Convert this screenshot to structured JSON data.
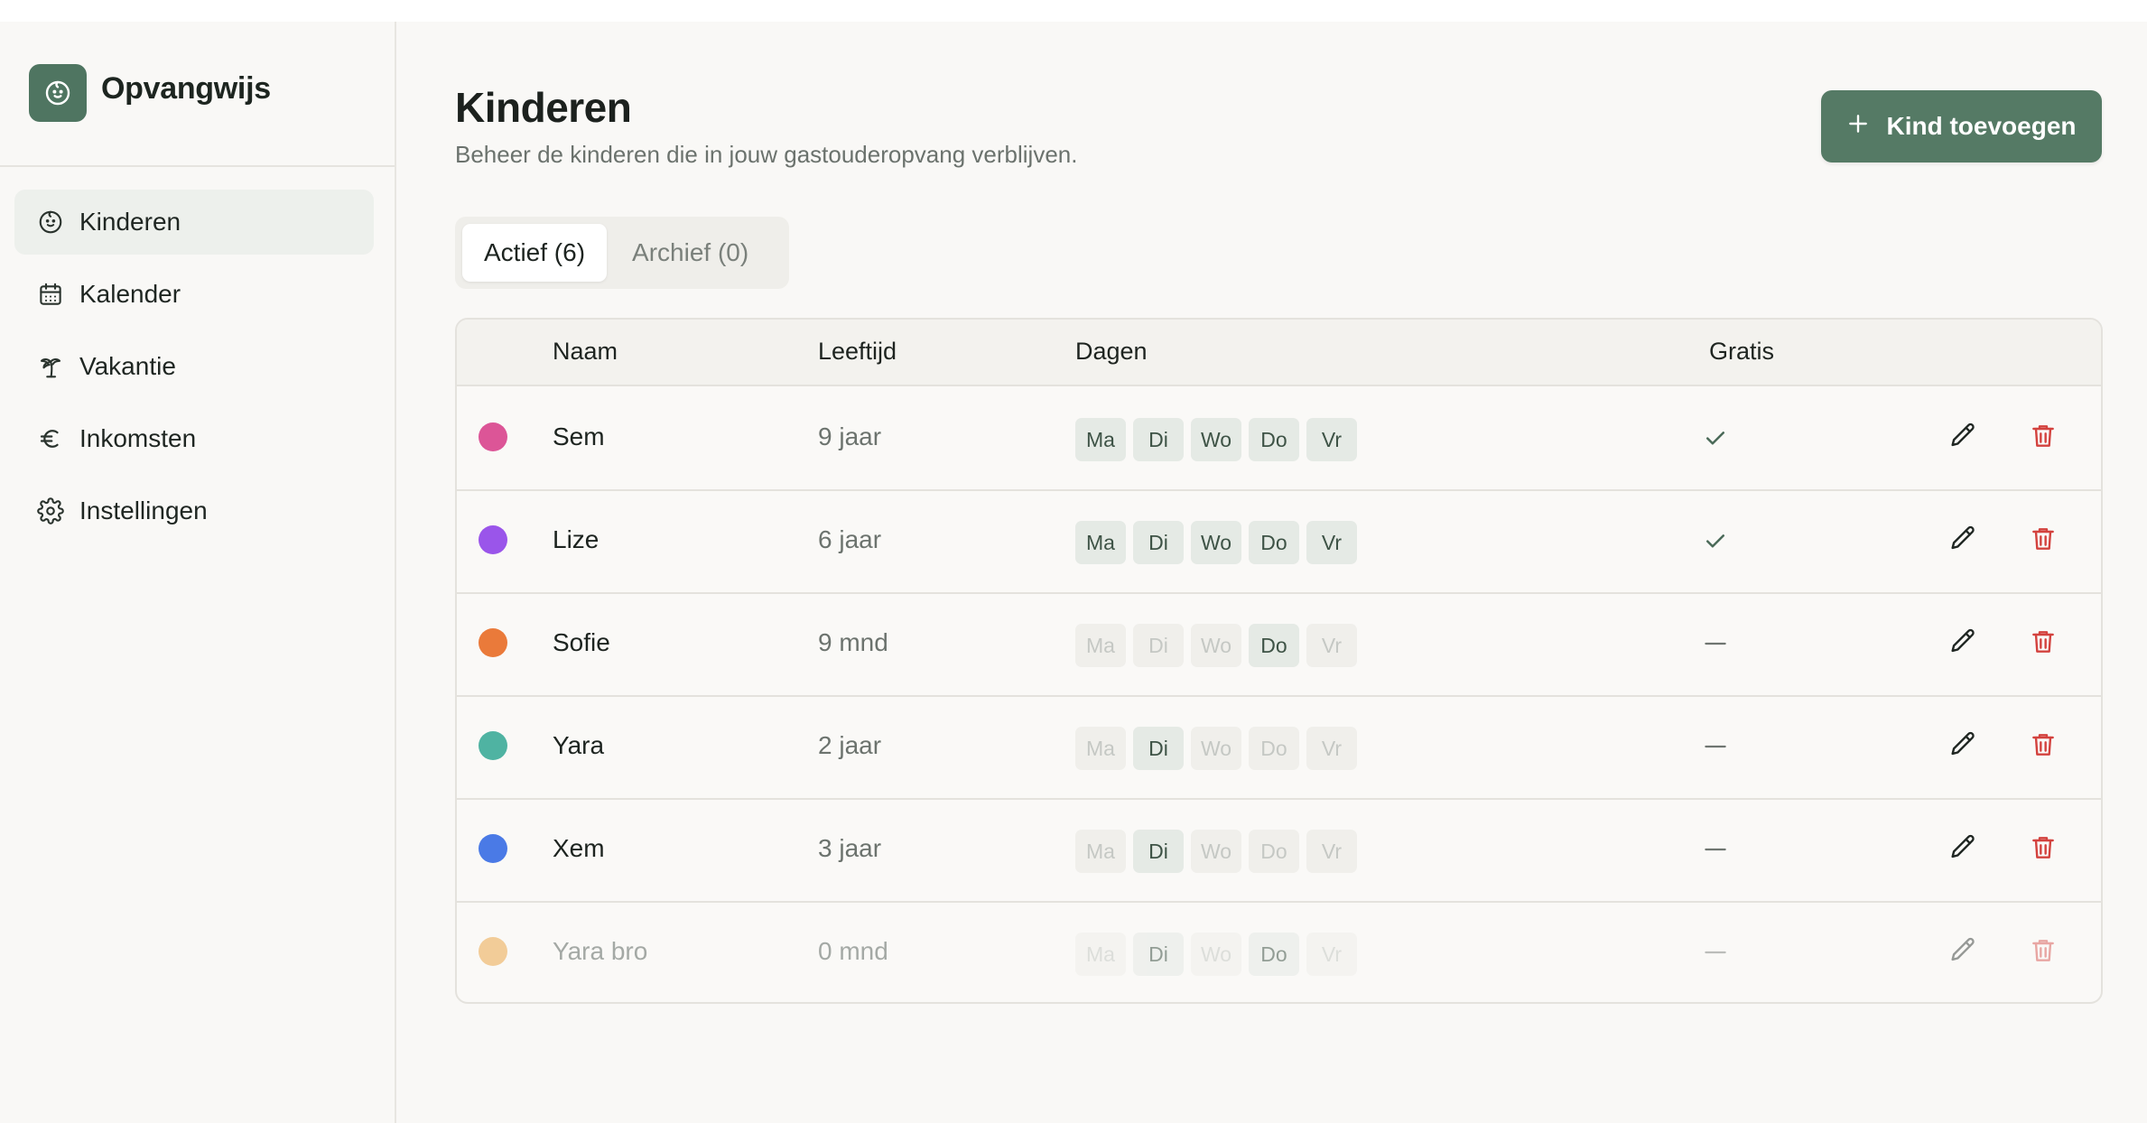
{
  "app": {
    "name": "Opvangwijs",
    "logo_icon": "baby-face-icon"
  },
  "sidebar": {
    "items": [
      {
        "label": "Kinderen",
        "icon": "baby-face-icon",
        "active": true
      },
      {
        "label": "Kalender",
        "icon": "calendar-icon",
        "active": false
      },
      {
        "label": "Vakantie",
        "icon": "palm-tree-icon",
        "active": false
      },
      {
        "label": "Inkomsten",
        "icon": "euro-icon",
        "active": false
      },
      {
        "label": "Instellingen",
        "icon": "gear-icon",
        "active": false
      }
    ]
  },
  "page": {
    "title": "Kinderen",
    "subtitle": "Beheer de kinderen die in jouw gastouderopvang verblijven.",
    "add_button_label": "Kind toevoegen"
  },
  "tabs": [
    {
      "label": "Actief (6)",
      "active": true
    },
    {
      "label": "Archief (0)",
      "active": false
    }
  ],
  "table": {
    "columns": [
      "Naam",
      "Leeftijd",
      "Dagen",
      "Gratis"
    ],
    "day_labels": [
      "Ma",
      "Di",
      "Wo",
      "Do",
      "Vr"
    ],
    "rows": [
      {
        "name": "Sem",
        "age": "9 jaar",
        "color": "#dc5597",
        "days": [
          true,
          true,
          true,
          true,
          true
        ],
        "gratis": true,
        "dimmed": false
      },
      {
        "name": "Lize",
        "age": "6 jaar",
        "color": "#9a55ea",
        "days": [
          true,
          true,
          true,
          true,
          true
        ],
        "gratis": true,
        "dimmed": false
      },
      {
        "name": "Sofie",
        "age": "9 mnd",
        "color": "#ea7a3a",
        "days": [
          false,
          false,
          false,
          true,
          false
        ],
        "gratis": false,
        "dimmed": false
      },
      {
        "name": "Yara",
        "age": "2 jaar",
        "color": "#4fb3a2",
        "days": [
          false,
          true,
          false,
          false,
          false
        ],
        "gratis": false,
        "dimmed": false
      },
      {
        "name": "Xem",
        "age": "3 jaar",
        "color": "#4a7ae6",
        "days": [
          false,
          true,
          false,
          false,
          false
        ],
        "gratis": false,
        "dimmed": false
      },
      {
        "name": "Yara bro",
        "age": "0 mnd",
        "color": "#f2cc98",
        "days": [
          false,
          true,
          false,
          true,
          false
        ],
        "gratis": false,
        "dimmed": true
      }
    ]
  },
  "colors": {
    "accent": "#557a65",
    "delete": "#d3423e",
    "sidebar_active": "#edf0ec"
  }
}
